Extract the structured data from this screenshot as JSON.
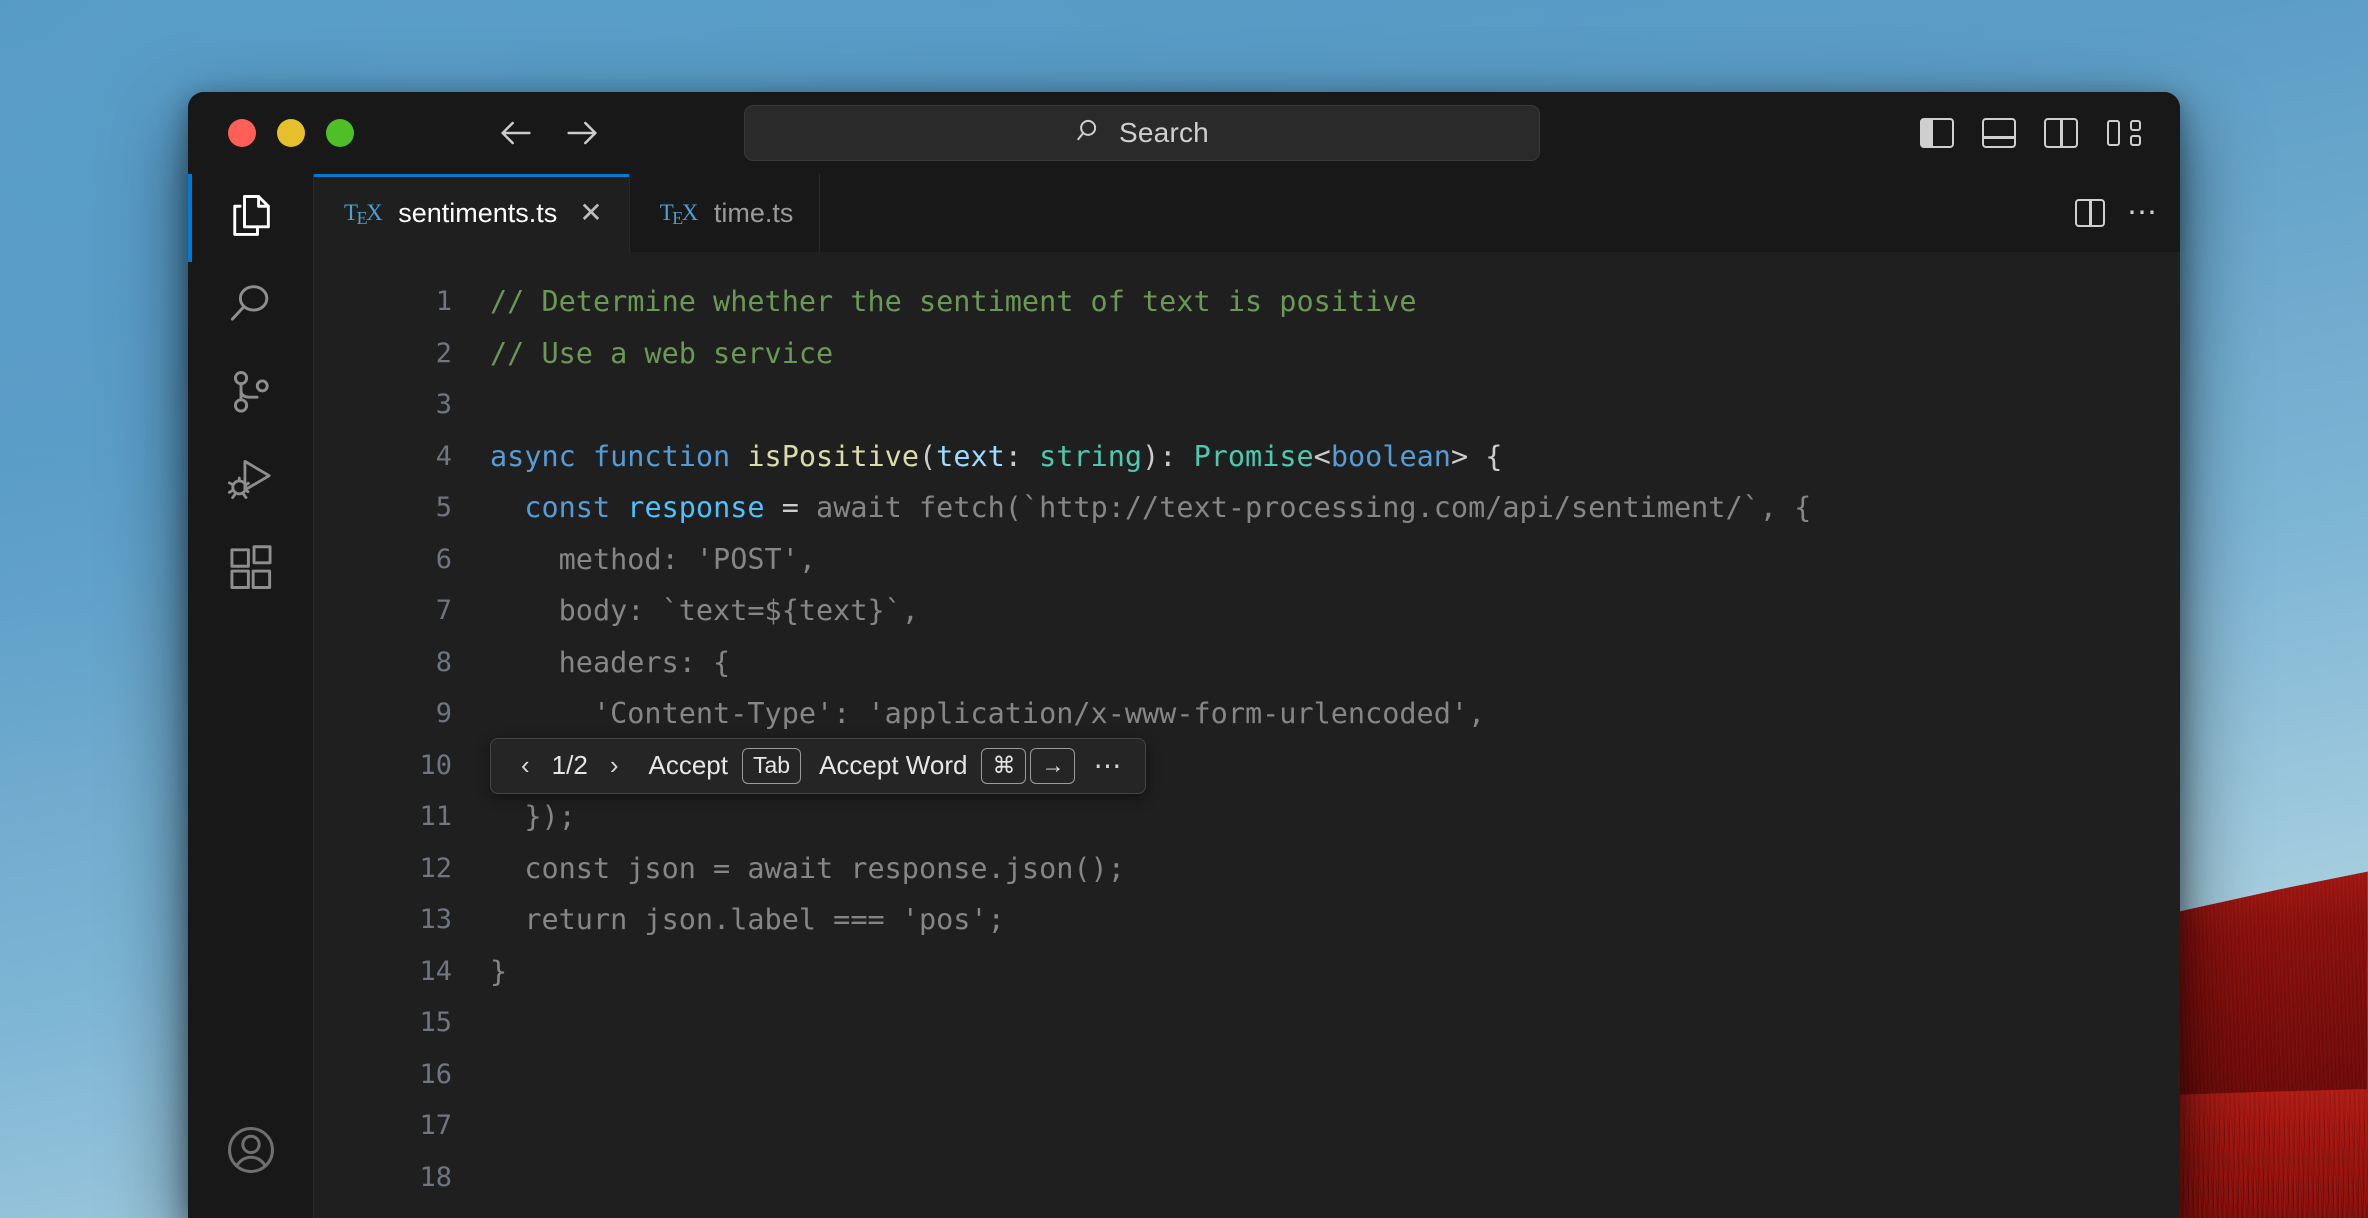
{
  "window": {
    "traffic_lights": [
      {
        "name": "close",
        "color": "#ff5f57"
      },
      {
        "name": "minimize",
        "color": "#e6c02c"
      },
      {
        "name": "maximize",
        "color": "#4fbf28"
      }
    ]
  },
  "titlebar": {
    "back_icon": "arrow-left-icon",
    "forward_icon": "arrow-right-icon",
    "search": {
      "icon": "search-icon",
      "label": "Search",
      "placeholder": "Search",
      "value": ""
    },
    "layout_controls": [
      {
        "name": "toggle-primary-sidebar",
        "icon": "layout-sidebar-left-icon"
      },
      {
        "name": "toggle-panel",
        "icon": "layout-panel-icon"
      },
      {
        "name": "toggle-secondary-sidebar",
        "icon": "layout-sidebar-right-icon"
      },
      {
        "name": "customize-layout",
        "icon": "layout-customize-icon"
      }
    ]
  },
  "activitybar": {
    "items": [
      {
        "name": "explorer",
        "icon": "files-icon",
        "active": true
      },
      {
        "name": "search",
        "icon": "search-icon",
        "active": false
      },
      {
        "name": "source-control",
        "icon": "source-control-icon",
        "active": false
      },
      {
        "name": "run-and-debug",
        "icon": "run-debug-icon",
        "active": false
      },
      {
        "name": "extensions",
        "icon": "extensions-icon",
        "active": false
      }
    ],
    "bottom": [
      {
        "name": "accounts",
        "icon": "account-icon"
      }
    ],
    "active_indicator_color": "#0078d4"
  },
  "tabs": {
    "items": [
      {
        "label": "sentiments.ts",
        "icon": "tex-icon",
        "active": true,
        "close_icon": "✕"
      },
      {
        "label": "time.ts",
        "icon": "tex-icon",
        "active": false,
        "close_icon": ""
      }
    ],
    "actions": [
      {
        "name": "split-editor-right",
        "icon": "split-editor-icon"
      },
      {
        "name": "more-actions",
        "icon": "ellipsis-icon",
        "glyph": "⋯"
      }
    ]
  },
  "editor": {
    "language": "typescript",
    "theme": "dark-modern",
    "colors": {
      "background": "#1f1f1f",
      "comment": "#6a9955",
      "keyword": "#569cd6",
      "function": "#dcdcaa",
      "variable": "#9cdcfe",
      "type": "#4ec9b0",
      "constant": "#4fc1ff",
      "plain": "#cccccc",
      "ghost_text": "#868686",
      "line_number": "#6e7681"
    },
    "lines": [
      {
        "n": "1",
        "tokens": [
          {
            "t": "// Determine whether the sentiment of text is positive",
            "c": "t-com"
          }
        ]
      },
      {
        "n": "2",
        "tokens": [
          {
            "t": "// Use a web service",
            "c": "t-com"
          }
        ]
      },
      {
        "n": "3",
        "tokens": []
      },
      {
        "n": "4",
        "tokens": [
          {
            "t": "async ",
            "c": "t-kw"
          },
          {
            "t": "function ",
            "c": "t-kw"
          },
          {
            "t": "isPositive",
            "c": "t-fn"
          },
          {
            "t": "(",
            "c": "t-plain"
          },
          {
            "t": "text",
            "c": "t-var"
          },
          {
            "t": ": ",
            "c": "t-plain"
          },
          {
            "t": "string",
            "c": "t-type"
          },
          {
            "t": "): ",
            "c": "t-plain"
          },
          {
            "t": "Promise",
            "c": "t-type"
          },
          {
            "t": "<",
            "c": "t-plain"
          },
          {
            "t": "boolean",
            "c": "t-kw"
          },
          {
            "t": "> {",
            "c": "t-plain"
          }
        ]
      },
      {
        "n": "5",
        "tokens": [
          {
            "t": "  ",
            "c": "t-plain"
          },
          {
            "t": "const ",
            "c": "t-kw"
          },
          {
            "t": "response",
            "c": "t-cvar"
          },
          {
            "t": " = ",
            "c": "t-plain"
          },
          {
            "t": "await fetch(`http://text-processing.com/api/sentiment/`, {",
            "c": "t-ghost"
          }
        ]
      },
      {
        "n": "6",
        "tokens": [
          {
            "t": "    method: 'POST',",
            "c": "t-ghost"
          }
        ]
      },
      {
        "n": "7",
        "tokens": [
          {
            "t": "    body: `text=${text}`,",
            "c": "t-ghost"
          }
        ]
      },
      {
        "n": "8",
        "tokens": [
          {
            "t": "    headers: {",
            "c": "t-ghost"
          }
        ]
      },
      {
        "n": "9",
        "tokens": [
          {
            "t": "      'Content-Type': 'application/x-www-form-urlencoded',",
            "c": "t-ghost"
          }
        ]
      },
      {
        "n": "10",
        "tokens": [
          {
            "t": "    },",
            "c": "t-ghost"
          }
        ]
      },
      {
        "n": "11",
        "tokens": [
          {
            "t": "  });",
            "c": "t-ghost"
          }
        ]
      },
      {
        "n": "12",
        "tokens": [
          {
            "t": "  const json = await response.json();",
            "c": "t-ghost"
          }
        ]
      },
      {
        "n": "13",
        "tokens": [
          {
            "t": "  return json.label === 'pos';",
            "c": "t-ghost"
          }
        ]
      },
      {
        "n": "14",
        "tokens": [
          {
            "t": "}",
            "c": "t-ghost"
          }
        ]
      },
      {
        "n": "15",
        "tokens": []
      },
      {
        "n": "16",
        "tokens": []
      },
      {
        "n": "17",
        "tokens": []
      },
      {
        "n": "18",
        "tokens": []
      }
    ]
  },
  "suggestion_toolbar": {
    "prev_icon": "chevron-left-icon",
    "counter": "1/2",
    "next_icon": "chevron-right-icon",
    "accept_label": "Accept",
    "accept_key": "Tab",
    "accept_word_label": "Accept Word",
    "accept_word_key_1": "⌘",
    "accept_word_key_2": "→",
    "more_icon": "ellipsis-icon",
    "more_glyph": "⋯"
  }
}
